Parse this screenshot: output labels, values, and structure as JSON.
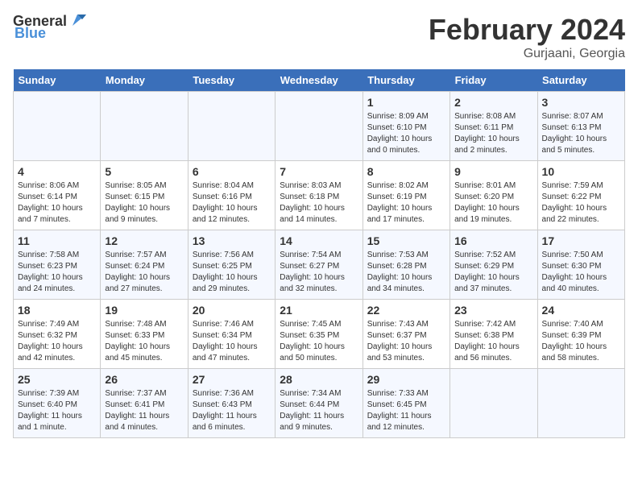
{
  "header": {
    "logo_general": "General",
    "logo_blue": "Blue",
    "month_title": "February 2024",
    "location": "Gurjaani, Georgia"
  },
  "days_of_week": [
    "Sunday",
    "Monday",
    "Tuesday",
    "Wednesday",
    "Thursday",
    "Friday",
    "Saturday"
  ],
  "weeks": [
    [
      {
        "day": "",
        "info": ""
      },
      {
        "day": "",
        "info": ""
      },
      {
        "day": "",
        "info": ""
      },
      {
        "day": "",
        "info": ""
      },
      {
        "day": "1",
        "info": "Sunrise: 8:09 AM\nSunset: 6:10 PM\nDaylight: 10 hours\nand 0 minutes."
      },
      {
        "day": "2",
        "info": "Sunrise: 8:08 AM\nSunset: 6:11 PM\nDaylight: 10 hours\nand 2 minutes."
      },
      {
        "day": "3",
        "info": "Sunrise: 8:07 AM\nSunset: 6:13 PM\nDaylight: 10 hours\nand 5 minutes."
      }
    ],
    [
      {
        "day": "4",
        "info": "Sunrise: 8:06 AM\nSunset: 6:14 PM\nDaylight: 10 hours\nand 7 minutes."
      },
      {
        "day": "5",
        "info": "Sunrise: 8:05 AM\nSunset: 6:15 PM\nDaylight: 10 hours\nand 9 minutes."
      },
      {
        "day": "6",
        "info": "Sunrise: 8:04 AM\nSunset: 6:16 PM\nDaylight: 10 hours\nand 12 minutes."
      },
      {
        "day": "7",
        "info": "Sunrise: 8:03 AM\nSunset: 6:18 PM\nDaylight: 10 hours\nand 14 minutes."
      },
      {
        "day": "8",
        "info": "Sunrise: 8:02 AM\nSunset: 6:19 PM\nDaylight: 10 hours\nand 17 minutes."
      },
      {
        "day": "9",
        "info": "Sunrise: 8:01 AM\nSunset: 6:20 PM\nDaylight: 10 hours\nand 19 minutes."
      },
      {
        "day": "10",
        "info": "Sunrise: 7:59 AM\nSunset: 6:22 PM\nDaylight: 10 hours\nand 22 minutes."
      }
    ],
    [
      {
        "day": "11",
        "info": "Sunrise: 7:58 AM\nSunset: 6:23 PM\nDaylight: 10 hours\nand 24 minutes."
      },
      {
        "day": "12",
        "info": "Sunrise: 7:57 AM\nSunset: 6:24 PM\nDaylight: 10 hours\nand 27 minutes."
      },
      {
        "day": "13",
        "info": "Sunrise: 7:56 AM\nSunset: 6:25 PM\nDaylight: 10 hours\nand 29 minutes."
      },
      {
        "day": "14",
        "info": "Sunrise: 7:54 AM\nSunset: 6:27 PM\nDaylight: 10 hours\nand 32 minutes."
      },
      {
        "day": "15",
        "info": "Sunrise: 7:53 AM\nSunset: 6:28 PM\nDaylight: 10 hours\nand 34 minutes."
      },
      {
        "day": "16",
        "info": "Sunrise: 7:52 AM\nSunset: 6:29 PM\nDaylight: 10 hours\nand 37 minutes."
      },
      {
        "day": "17",
        "info": "Sunrise: 7:50 AM\nSunset: 6:30 PM\nDaylight: 10 hours\nand 40 minutes."
      }
    ],
    [
      {
        "day": "18",
        "info": "Sunrise: 7:49 AM\nSunset: 6:32 PM\nDaylight: 10 hours\nand 42 minutes."
      },
      {
        "day": "19",
        "info": "Sunrise: 7:48 AM\nSunset: 6:33 PM\nDaylight: 10 hours\nand 45 minutes."
      },
      {
        "day": "20",
        "info": "Sunrise: 7:46 AM\nSunset: 6:34 PM\nDaylight: 10 hours\nand 47 minutes."
      },
      {
        "day": "21",
        "info": "Sunrise: 7:45 AM\nSunset: 6:35 PM\nDaylight: 10 hours\nand 50 minutes."
      },
      {
        "day": "22",
        "info": "Sunrise: 7:43 AM\nSunset: 6:37 PM\nDaylight: 10 hours\nand 53 minutes."
      },
      {
        "day": "23",
        "info": "Sunrise: 7:42 AM\nSunset: 6:38 PM\nDaylight: 10 hours\nand 56 minutes."
      },
      {
        "day": "24",
        "info": "Sunrise: 7:40 AM\nSunset: 6:39 PM\nDaylight: 10 hours\nand 58 minutes."
      }
    ],
    [
      {
        "day": "25",
        "info": "Sunrise: 7:39 AM\nSunset: 6:40 PM\nDaylight: 11 hours\nand 1 minute."
      },
      {
        "day": "26",
        "info": "Sunrise: 7:37 AM\nSunset: 6:41 PM\nDaylight: 11 hours\nand 4 minutes."
      },
      {
        "day": "27",
        "info": "Sunrise: 7:36 AM\nSunset: 6:43 PM\nDaylight: 11 hours\nand 6 minutes."
      },
      {
        "day": "28",
        "info": "Sunrise: 7:34 AM\nSunset: 6:44 PM\nDaylight: 11 hours\nand 9 minutes."
      },
      {
        "day": "29",
        "info": "Sunrise: 7:33 AM\nSunset: 6:45 PM\nDaylight: 11 hours\nand 12 minutes."
      },
      {
        "day": "",
        "info": ""
      },
      {
        "day": "",
        "info": ""
      }
    ]
  ]
}
